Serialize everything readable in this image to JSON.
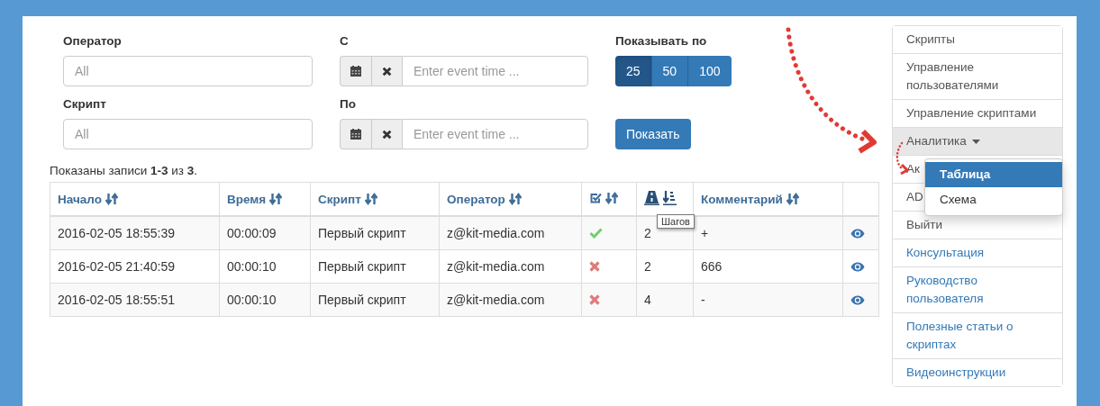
{
  "filters": [
    {
      "label": "Оператор",
      "kind": "select",
      "placeholder": "All"
    },
    {
      "label": "С",
      "kind": "datetime",
      "placeholder": "Enter event time ..."
    },
    {
      "label": "Скрипт",
      "kind": "select",
      "placeholder": "All"
    },
    {
      "label": "По",
      "kind": "datetime",
      "placeholder": "Enter event time ..."
    }
  ],
  "page_size": {
    "label": "Показывать по",
    "options": [
      {
        "label": "25",
        "selected": true
      },
      {
        "label": "50",
        "selected": false
      },
      {
        "label": "100",
        "selected": false
      }
    ]
  },
  "show_button": "Показать",
  "summary": "Показаны записи **1-3** из **3**.",
  "table": {
    "columns": [
      {
        "kind": "text",
        "label": "Начало"
      },
      {
        "kind": "text",
        "label": "Время"
      },
      {
        "kind": "text",
        "label": "Скрипт"
      },
      {
        "kind": "text",
        "label": "Оператор"
      },
      {
        "kind": "status"
      },
      {
        "kind": "steps"
      },
      {
        "kind": "text",
        "label": "Комментарий"
      },
      {
        "kind": "blank"
      }
    ],
    "tooltip": "Шагов",
    "rows": [
      {
        "start": "2016-02-05 18:55:39",
        "time": "00:00:09",
        "script": "Первый скрипт",
        "operator": "z@kit-media.com",
        "success": true,
        "steps": "2",
        "comment": "+"
      },
      {
        "start": "2016-02-05 21:40:59",
        "time": "00:00:10",
        "script": "Первый скрипт",
        "operator": "z@kit-media.com",
        "success": false,
        "steps": "2",
        "comment": "666"
      },
      {
        "start": "2016-02-05 18:55:51",
        "time": "00:00:10",
        "script": "Первый скрипт",
        "operator": "z@kit-media.com",
        "success": false,
        "steps": "4",
        "comment": "-"
      }
    ]
  },
  "sidebar": {
    "items": [
      {
        "label": "Скрипты",
        "kind": "plain",
        "expanded": false
      },
      {
        "label": "Управление пользователями",
        "kind": "plain",
        "expanded": false
      },
      {
        "label": "Управление скриптами",
        "kind": "plain",
        "expanded": false
      },
      {
        "label": "Аналитика",
        "kind": "dropdown",
        "expanded": true,
        "children": [
          {
            "label": "Таблица",
            "selected": true
          },
          {
            "label": "Схема",
            "selected": false
          }
        ]
      },
      {
        "label": "Ак",
        "kind": "plain",
        "expanded": false
      },
      {
        "label": "AD",
        "kind": "plain",
        "expanded": false
      },
      {
        "label": "Выйти",
        "kind": "plain",
        "expanded": false
      },
      {
        "label": "Консультация",
        "kind": "link",
        "expanded": false
      },
      {
        "label": "Руководство пользователя",
        "kind": "link",
        "expanded": false
      },
      {
        "label": "Полезные статьи о скриптах",
        "kind": "link",
        "expanded": false
      },
      {
        "label": "Видеоинструкции",
        "kind": "link",
        "expanded": false
      }
    ]
  }
}
